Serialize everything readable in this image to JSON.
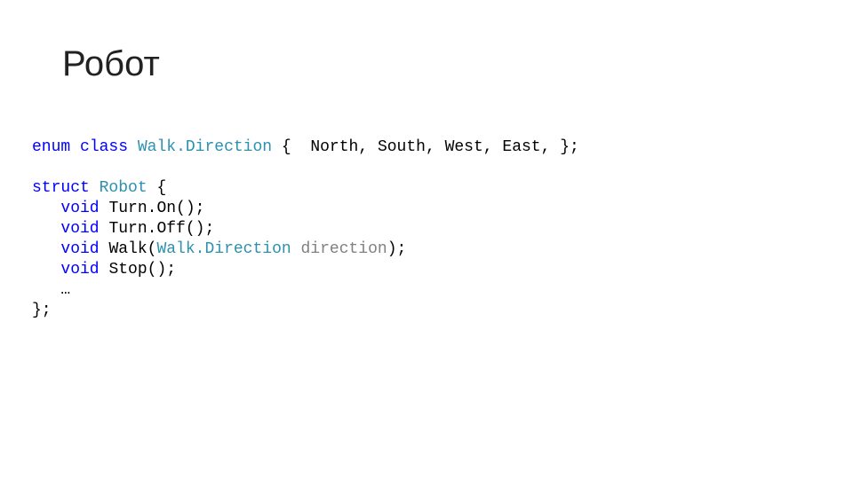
{
  "title": "Робот",
  "code": {
    "l1": {
      "enum": "enum",
      "class": "class",
      "WalkDirection": "Walk.Direction",
      "open": " {  ",
      "North": "North",
      "South": "South",
      "West": "West",
      "East": "East",
      "close": " };",
      "comma": ", "
    },
    "l3": {
      "struct": "struct",
      "Robot": "Robot",
      "open": " {"
    },
    "l4": {
      "void": "void",
      "fn": "Turn.On();"
    },
    "l5": {
      "void": "void",
      "fn": "Turn.Off();"
    },
    "l6": {
      "void": "void",
      "fn_a": "Walk(",
      "argtype": "Walk.Direction",
      "argname": " direction",
      "fn_b": ");"
    },
    "l7": {
      "void": "void",
      "fn": "Stop();"
    },
    "l8": {
      "dots": "…"
    },
    "l9": {
      "close": "};"
    },
    "indent": "   "
  }
}
